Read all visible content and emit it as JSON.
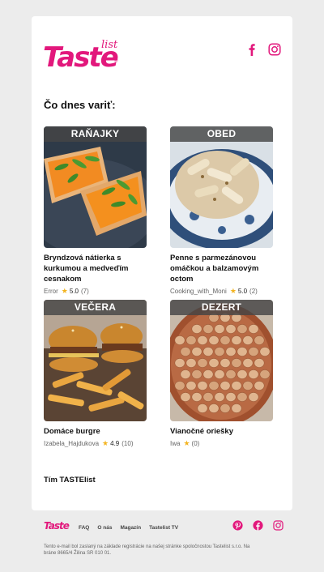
{
  "brand": {
    "logo_main": "Taste",
    "logo_sub": "list",
    "registered": "®"
  },
  "header": {
    "icons": [
      "facebook-icon",
      "instagram-icon"
    ]
  },
  "heading": "Čo dnes variť:",
  "recipes": [
    {
      "category": "RAŇAJKY",
      "title": "Bryndzová nátierka s kurkumou a medveďím cesnakom",
      "author": "Error",
      "rating": "5.0",
      "count": "(7)"
    },
    {
      "category": "OBED",
      "title": "Penne s parmezánovou omáčkou a balzamovým octom",
      "author": "Cooking_with_Moni",
      "rating": "5.0",
      "count": "(2)"
    },
    {
      "category": "VEČERA",
      "title": "Domáce burgre",
      "author": "Izabela_Hajdukova",
      "rating": "4.9",
      "count": "(10)"
    },
    {
      "category": "DEZERT",
      "title": "Vianočné oriešky",
      "author": "Iwa",
      "rating": "",
      "count": "(0)"
    }
  ],
  "signature": "Tím TASTElist",
  "footer": {
    "logo": "Taste",
    "links": [
      "FAQ",
      "O nás",
      "Magazín",
      "Tastelist TV"
    ],
    "icons": [
      "pinterest-icon",
      "facebook-icon",
      "instagram-icon"
    ],
    "disclaimer": "Tento e-mail bol zaslaný na základe registrácie na našej stránke spoločnostou Tastelist s.r.o. Na bráne 8665/4 Žilina SR 010 01."
  },
  "colors": {
    "brand": "#e2187c",
    "star": "#f3b420",
    "category_bg": "#464646"
  }
}
